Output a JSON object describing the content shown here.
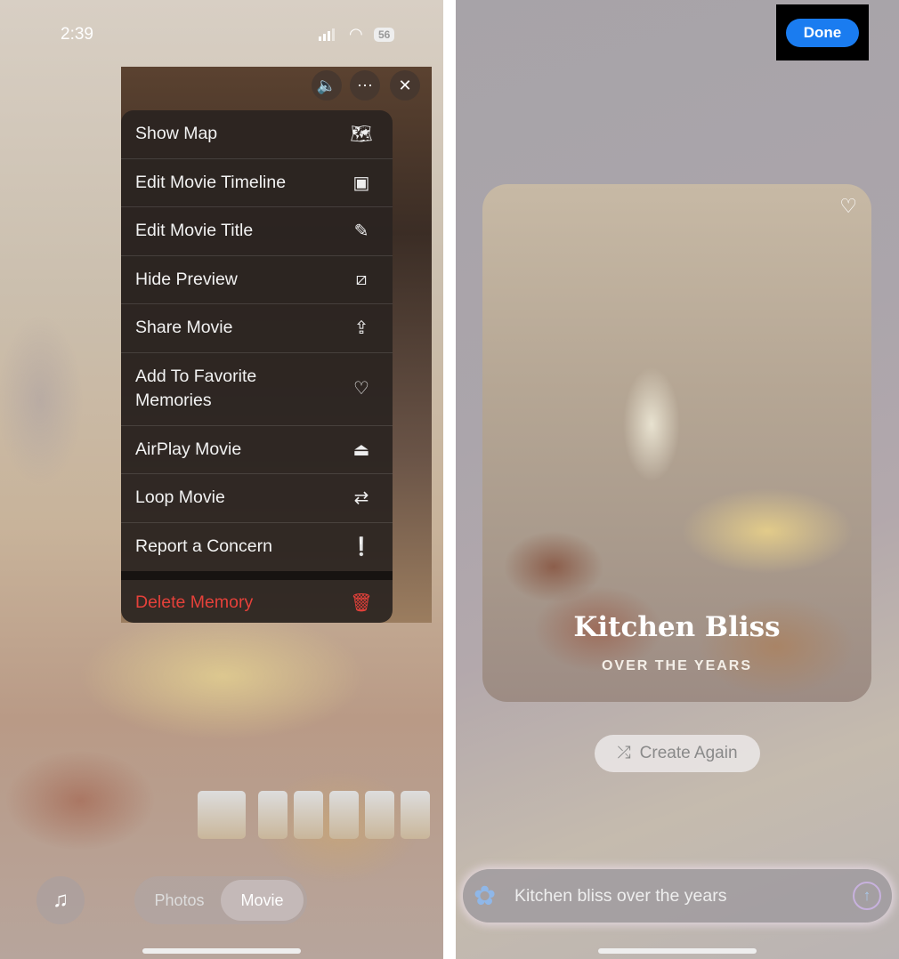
{
  "left": {
    "status": {
      "time": "2:39",
      "battery": "56"
    },
    "video_controls": {
      "sound_icon": "speaker-wave-icon",
      "more_icon": "ellipsis-icon",
      "close_icon": "close-icon"
    },
    "menu": [
      {
        "label": "Show Map",
        "icon": "map-icon",
        "glyph": "🗺"
      },
      {
        "label": "Edit Movie Timeline",
        "icon": "photos-stack-icon",
        "glyph": "▣"
      },
      {
        "label": "Edit Movie Title",
        "icon": "pencil-icon",
        "glyph": "✎"
      },
      {
        "label": "Hide Preview",
        "icon": "preview-slash-icon",
        "glyph": "⧄"
      },
      {
        "label": "Share Movie",
        "icon": "share-icon",
        "glyph": "⇪"
      },
      {
        "label": "Add To Favorite Memories",
        "icon": "heart-icon",
        "glyph": "♡"
      },
      {
        "label": "AirPlay Movie",
        "icon": "airplay-icon",
        "glyph": "⏏"
      },
      {
        "label": "Loop Movie",
        "icon": "loop-icon",
        "glyph": "⇄"
      },
      {
        "label": "Report a Concern",
        "icon": "exclamation-bubble-icon",
        "glyph": "❕"
      }
    ],
    "delete": {
      "label": "Delete Memory",
      "icon": "trash-icon",
      "glyph": "🗑",
      "color": "#e5413a"
    },
    "segment": {
      "photos": "Photos",
      "movie": "Movie",
      "selected": "Movie"
    },
    "music_icon": "music-sparkle-icon"
  },
  "right": {
    "done": "Done",
    "accent": "#1a7cf0",
    "card": {
      "title": "Kitchen Bliss",
      "subtitle": "OVER THE YEARS"
    },
    "create_again": "Create Again",
    "prompt": {
      "value": "Kitchen bliss over the years"
    }
  }
}
